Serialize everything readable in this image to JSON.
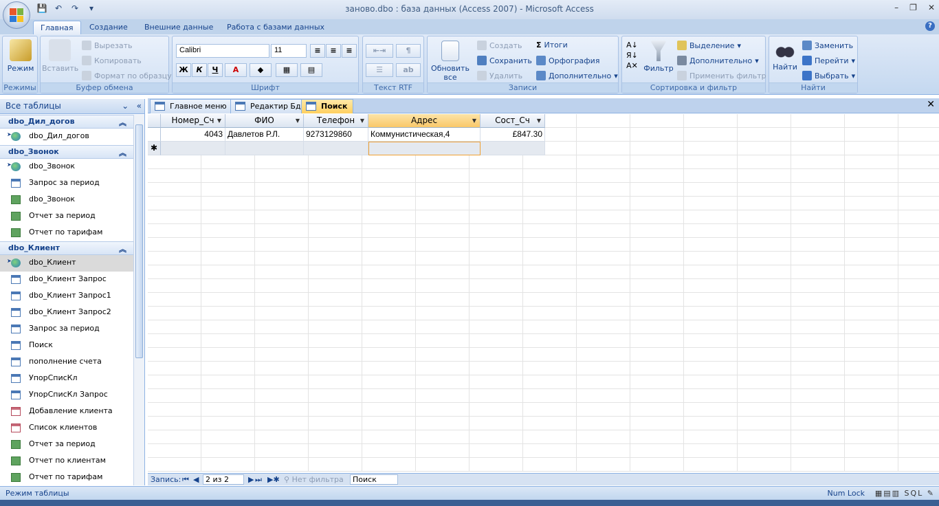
{
  "window": {
    "title": "заново.dbo : база данных (Access 2007) - Microsoft Access",
    "minimize": "–",
    "restore": "❐",
    "close": "✕"
  },
  "qat": {
    "save": "💾",
    "undo": "↶",
    "redo": "↷",
    "customize": "▾"
  },
  "tabs": [
    "Главная",
    "Создание",
    "Внешние данные",
    "Работа с базами данных"
  ],
  "help": "?",
  "ribbon": {
    "groups": {
      "views": "Режимы",
      "clipboard": "Буфер обмена",
      "font": "Шрифт",
      "rtf": "Текст RTF",
      "records": "Записи",
      "sort": "Сортировка и фильтр",
      "find": "Найти"
    },
    "view_btn": "Режим",
    "paste_btn": "Вставить",
    "cut": "Вырезать",
    "copy": "Копировать",
    "format_painter": "Формат по образцу",
    "font_name": "Calibri",
    "font_size": "11",
    "bold": "Ж",
    "italic": "К",
    "underline": "Ч",
    "refresh_btn": "Обновить все",
    "new": "Создать",
    "save": "Сохранить",
    "delete": "Удалить",
    "totals": "Итоги",
    "spelling": "Орфография",
    "more": "Дополнительно",
    "filter_btn": "Фильтр",
    "selection": "Выделение",
    "advanced": "Дополнительно",
    "toggle_filter": "Применить фильтр",
    "find_btn": "Найти",
    "replace": "Заменить",
    "goto": "Перейти",
    "select": "Выбрать"
  },
  "nav": {
    "header": "Все таблицы",
    "groups": [
      {
        "name": "dbo_Дил_догов",
        "items": [
          {
            "label": "dbo_Дил_догов",
            "type": "globe",
            "linked": true
          }
        ]
      },
      {
        "name": "dbo_Звонок",
        "items": [
          {
            "label": "dbo_Звонок",
            "type": "globe",
            "linked": true
          },
          {
            "label": "Запрос за период",
            "type": "query"
          },
          {
            "label": "dbo_Звонок",
            "type": "report"
          },
          {
            "label": "Отчет за период",
            "type": "report"
          },
          {
            "label": "Отчет по тарифам",
            "type": "report"
          }
        ]
      },
      {
        "name": "dbo_Клиент",
        "items": [
          {
            "label": "dbo_Клиент",
            "type": "globe",
            "linked": true,
            "selected": true
          },
          {
            "label": "dbo_Клиент Запрос",
            "type": "query"
          },
          {
            "label": "dbo_Клиент Запрос1",
            "type": "query"
          },
          {
            "label": "dbo_Клиент Запрос2",
            "type": "query"
          },
          {
            "label": "Запрос за период",
            "type": "query"
          },
          {
            "label": "Поиск",
            "type": "query"
          },
          {
            "label": "пополнение счета",
            "type": "query"
          },
          {
            "label": "УпорСписКл",
            "type": "query"
          },
          {
            "label": "УпорСписКл Запрос",
            "type": "query"
          },
          {
            "label": "Добавление клиента",
            "type": "form"
          },
          {
            "label": "Список клиентов",
            "type": "form"
          },
          {
            "label": "Отчет за период",
            "type": "report"
          },
          {
            "label": "Отчет по клиентам",
            "type": "report"
          },
          {
            "label": "Отчет по тарифам",
            "type": "report"
          }
        ]
      }
    ]
  },
  "doc_tabs": [
    {
      "label": "Главное меню",
      "active": false
    },
    {
      "label": "Редактир Бд",
      "active": false
    },
    {
      "label": "Поиск",
      "active": true
    }
  ],
  "datasheet": {
    "columns": [
      "Номер_Сч",
      "ФИО",
      "Телефон",
      "Адрес",
      "Сост_Сч"
    ],
    "rows": [
      [
        "4043",
        "Давлетов Р.Л.",
        "9273129860",
        "Коммунистическая,4",
        "£847.30"
      ]
    ],
    "new_row_marker": "✱"
  },
  "record_bar": {
    "label": "Запись:",
    "position": "2 из 2",
    "filter": "Нет фильтра",
    "search": "Поиск"
  },
  "status": {
    "left": "Режим таблицы",
    "numlock": "Num Lock"
  }
}
